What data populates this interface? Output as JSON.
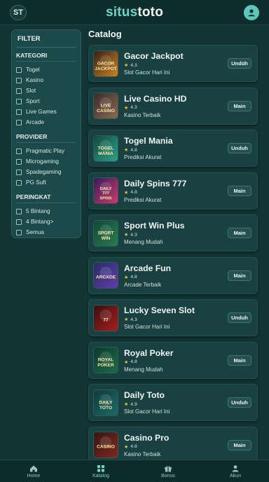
{
  "header": {
    "logo_text": "ST",
    "brand_part1": "situs",
    "brand_part2": "toto",
    "profile_icon": "user-circle-icon"
  },
  "filter": {
    "title": "FILTER",
    "groups": [
      {
        "title": "KATEGORI",
        "options": [
          "Togel",
          "Kasino",
          "Slot",
          "Sport",
          "Live Games",
          "Arcade"
        ]
      },
      {
        "title": "PROVIDER",
        "options": [
          "Pragmatic Play",
          "Microgaming",
          "Spadegaming",
          "PG Suft"
        ]
      },
      {
        "title": "PERINGKAT",
        "options": [
          "5 Bintang",
          "4 Bintang>",
          "Semua"
        ]
      }
    ]
  },
  "catalog": {
    "title": "Catalog",
    "items": [
      {
        "name": "Gacor Jackpot",
        "rating": "4.3",
        "desc": "Slot Gacor Hari Ini",
        "action": "Undüh",
        "thumb": "GACOR JACKPOT",
        "colors": [
          "#3b1e10",
          "#c5862b"
        ]
      },
      {
        "name": "Live Casino HD",
        "rating": "4.3",
        "desc": "Kasino Terbaik",
        "action": "Main",
        "thumb": "LIVE CASINO",
        "colors": [
          "#3a2a2a",
          "#8a6a52"
        ]
      },
      {
        "name": "Togel Mania",
        "rating": "4.8",
        "desc": "Prediksi Akurat",
        "action": "Unduh",
        "thumb": "TOGEL MANIA",
        "colors": [
          "#0e4a3e",
          "#2fa08a"
        ]
      },
      {
        "name": "Daily Spins 777",
        "rating": "4.8",
        "desc": "Prediksi Akurat",
        "action": "Main",
        "thumb": "DAILY 777 SPINS",
        "colors": [
          "#3a1b5b",
          "#c93c6b"
        ]
      },
      {
        "name": "Sport Win Plus",
        "rating": "4.3",
        "desc": "Menang Mudah",
        "action": "Main",
        "thumb": "SPORT WIN",
        "colors": [
          "#0f4a36",
          "#2b7a52"
        ]
      },
      {
        "name": "Arcade Fun",
        "rating": "4.8",
        "desc": "Arcade Terbaik",
        "action": "Main",
        "thumb": "ARCADE",
        "colors": [
          "#2a2a6a",
          "#5e3fa8"
        ]
      },
      {
        "name": "Lucky Seven Slot",
        "rating": "4.3",
        "desc": "Slot Gacor Hari Ini",
        "action": "Unduh",
        "thumb": "77",
        "colors": [
          "#3b0e0e",
          "#a62020"
        ]
      },
      {
        "name": "Royal Poker",
        "rating": "4.8",
        "desc": "Menang Mudah",
        "action": "Main",
        "thumb": "ROYAL POKER",
        "colors": [
          "#0c3a2c",
          "#1d6a4a"
        ]
      },
      {
        "name": "Daily Toto",
        "rating": "4.9",
        "desc": "Slot Gacor Hari Ini",
        "action": "Unduh",
        "thumb": "DAILY TOTO",
        "colors": [
          "#0f3b3b",
          "#1b6b66"
        ]
      },
      {
        "name": "Casino Pro",
        "rating": "4.8",
        "desc": "Kasino Terbaik",
        "action": "Main",
        "thumb": "CASINO",
        "colors": [
          "#3a1313",
          "#7a2b1e"
        ]
      }
    ]
  },
  "bottom_nav": {
    "items": [
      {
        "label": "Home",
        "icon": "home-icon"
      },
      {
        "label": "Katalog",
        "icon": "grid-icon"
      },
      {
        "label": "Bonus",
        "icon": "gift-icon"
      },
      {
        "label": "Akun",
        "icon": "user-icon"
      }
    ],
    "active_index": 1
  }
}
